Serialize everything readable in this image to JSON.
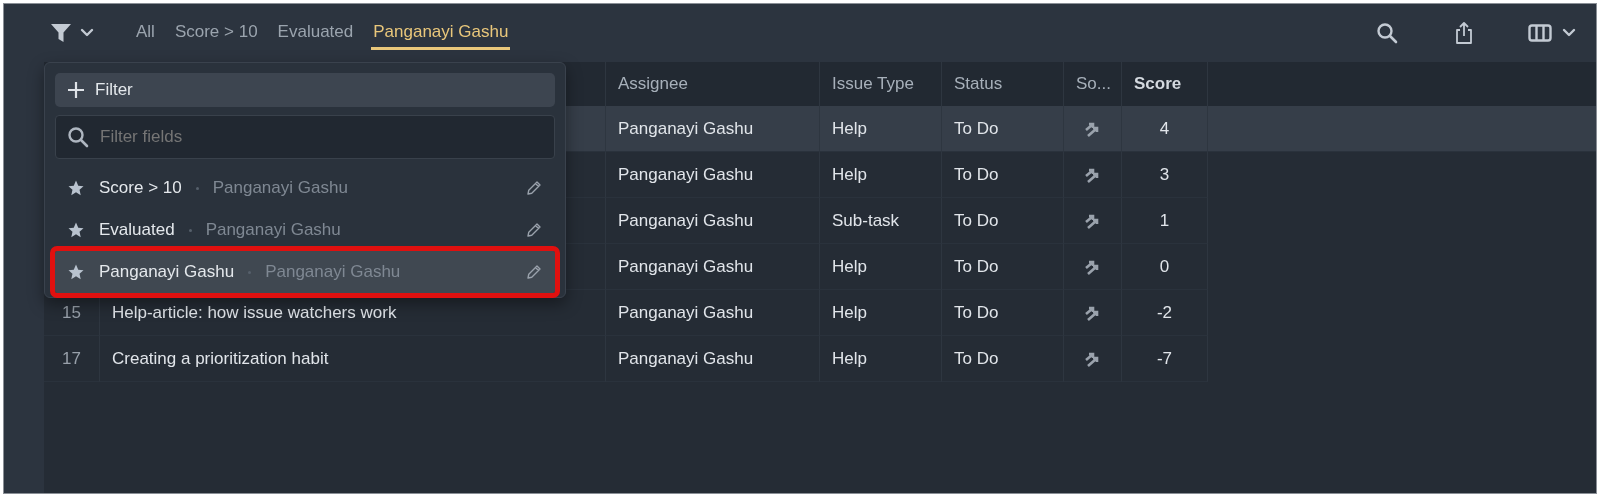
{
  "toolbar": {
    "tabs": [
      {
        "label": "All",
        "selected": false
      },
      {
        "label": "Score > 10",
        "selected": false
      },
      {
        "label": "Evaluated",
        "selected": false
      },
      {
        "label": "Panganayi Gashu",
        "selected": true
      }
    ]
  },
  "filter_menu": {
    "add_button": "Filter",
    "search": {
      "placeholder": "Filter fields"
    },
    "items": [
      {
        "name": "Score > 10",
        "owner": "Panganayi Gashu",
        "selected": false
      },
      {
        "name": "Evaluated",
        "owner": "Panganayi Gashu",
        "selected": false
      },
      {
        "name": "Panganayi Gashu",
        "owner": "Panganayi Gashu",
        "selected": true
      }
    ]
  },
  "table": {
    "columns": [
      {
        "label": "Assignee",
        "sorted": false
      },
      {
        "label": "Issue Type",
        "sorted": false
      },
      {
        "label": "Status",
        "sorted": false
      },
      {
        "label": "So...",
        "sorted": false
      },
      {
        "label": "Score",
        "sorted": true
      }
    ],
    "rows": [
      {
        "assignee": "Panganayi Gashu",
        "issue_type": "Help",
        "status": "To Do",
        "score": "4",
        "selected": true
      },
      {
        "assignee": "Panganayi Gashu",
        "issue_type": "Help",
        "status": "To Do",
        "score": "3",
        "selected": false
      },
      {
        "assignee": "Panganayi Gashu",
        "issue_type": "Sub-task",
        "status": "To Do",
        "score": "1",
        "selected": false
      },
      {
        "assignee": "Panganayi Gashu",
        "issue_type": "Help",
        "status": "To Do",
        "score": "0",
        "selected": false
      },
      {
        "number": "15",
        "title": "Help-article: how issue watchers work",
        "assignee": "Panganayi Gashu",
        "issue_type": "Help",
        "status": "To Do",
        "score": "-2",
        "selected": false
      },
      {
        "number": "17",
        "title": "Creating a prioritization habit",
        "assignee": "Panganayi Gashu",
        "issue_type": "Help",
        "status": "To Do",
        "score": "-7",
        "selected": false
      }
    ]
  }
}
